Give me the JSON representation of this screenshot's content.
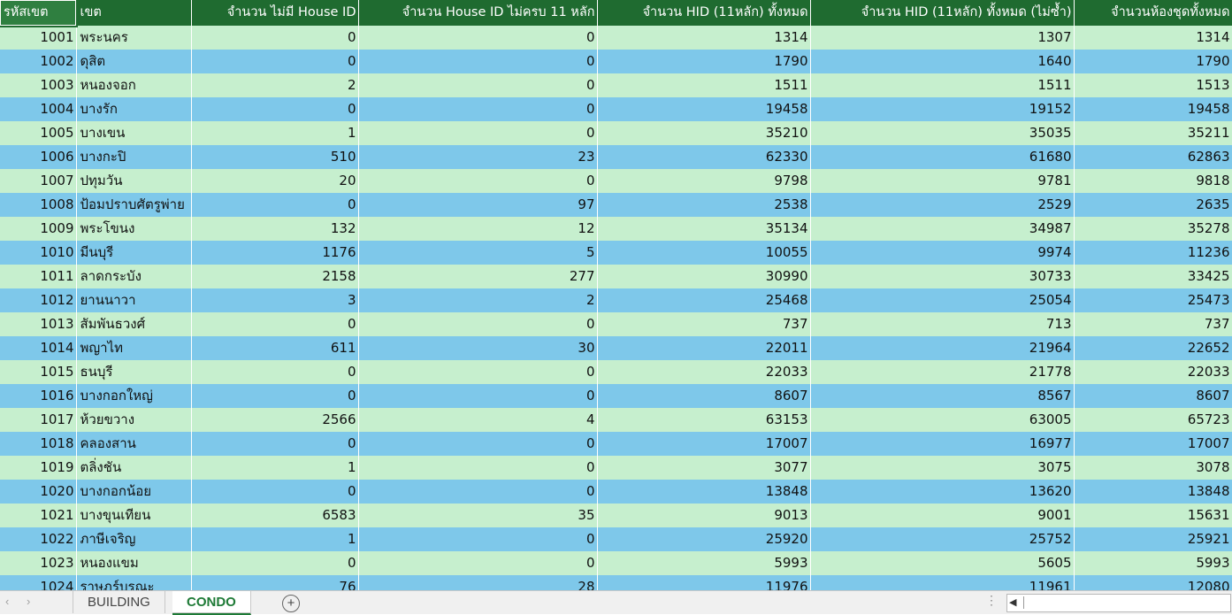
{
  "headers": [
    "รหัสเขต",
    "เขต",
    "จำนวน ไม่มี House ID",
    "จำนวน House ID ไม่ครบ 11 หลัก",
    "จำนวน HID (11หลัก) ทั้งหมด",
    "จำนวน HID (11หลัก) ทั้งหมด (ไม่ซ้ำ)",
    "จำนวนห้องชุดทั้งหมด"
  ],
  "rows": [
    [
      "1001",
      "พระนคร",
      "0",
      "0",
      "1314",
      "1307",
      "1314"
    ],
    [
      "1002",
      "ดุสิต",
      "0",
      "0",
      "1790",
      "1640",
      "1790"
    ],
    [
      "1003",
      "หนองจอก",
      "2",
      "0",
      "1511",
      "1511",
      "1513"
    ],
    [
      "1004",
      "บางรัก",
      "0",
      "0",
      "19458",
      "19152",
      "19458"
    ],
    [
      "1005",
      "บางเขน",
      "1",
      "0",
      "35210",
      "35035",
      "35211"
    ],
    [
      "1006",
      "บางกะปิ",
      "510",
      "23",
      "62330",
      "61680",
      "62863"
    ],
    [
      "1007",
      "ปทุมวัน",
      "20",
      "0",
      "9798",
      "9781",
      "9818"
    ],
    [
      "1008",
      "ป้อมปราบศัตรูพ่าย",
      "0",
      "97",
      "2538",
      "2529",
      "2635"
    ],
    [
      "1009",
      "พระโขนง",
      "132",
      "12",
      "35134",
      "34987",
      "35278"
    ],
    [
      "1010",
      "มีนบุรี",
      "1176",
      "5",
      "10055",
      "9974",
      "11236"
    ],
    [
      "1011",
      "ลาดกระบัง",
      "2158",
      "277",
      "30990",
      "30733",
      "33425"
    ],
    [
      "1012",
      "ยานนาวา",
      "3",
      "2",
      "25468",
      "25054",
      "25473"
    ],
    [
      "1013",
      "สัมพันธวงศ์",
      "0",
      "0",
      "737",
      "713",
      "737"
    ],
    [
      "1014",
      "พญาไท",
      "611",
      "30",
      "22011",
      "21964",
      "22652"
    ],
    [
      "1015",
      "ธนบุรี",
      "0",
      "0",
      "22033",
      "21778",
      "22033"
    ],
    [
      "1016",
      "บางกอกใหญ่",
      "0",
      "0",
      "8607",
      "8567",
      "8607"
    ],
    [
      "1017",
      "ห้วยขวาง",
      "2566",
      "4",
      "63153",
      "63005",
      "65723"
    ],
    [
      "1018",
      "คลองสาน",
      "0",
      "0",
      "17007",
      "16977",
      "17007"
    ],
    [
      "1019",
      "ตลิ่งชัน",
      "1",
      "0",
      "3077",
      "3075",
      "3078"
    ],
    [
      "1020",
      "บางกอกน้อย",
      "0",
      "0",
      "13848",
      "13620",
      "13848"
    ],
    [
      "1021",
      "บางขุนเทียน",
      "6583",
      "35",
      "9013",
      "9001",
      "15631"
    ],
    [
      "1022",
      "ภาษีเจริญ",
      "1",
      "0",
      "25920",
      "25752",
      "25921"
    ],
    [
      "1023",
      "หนองแขม",
      "0",
      "0",
      "5993",
      "5605",
      "5993"
    ],
    [
      "1024",
      "ราษฎร์บูรณะ",
      "76",
      "28",
      "11976",
      "11961",
      "12080"
    ]
  ],
  "tabs": [
    "BUILDING",
    "CONDO"
  ],
  "active_tab": "CONDO",
  "colors": {
    "header_bg": "#1f6b30",
    "row_green": "#c6efce",
    "row_blue": "#7ec8ea",
    "active_tab": "#1e7a36"
  }
}
